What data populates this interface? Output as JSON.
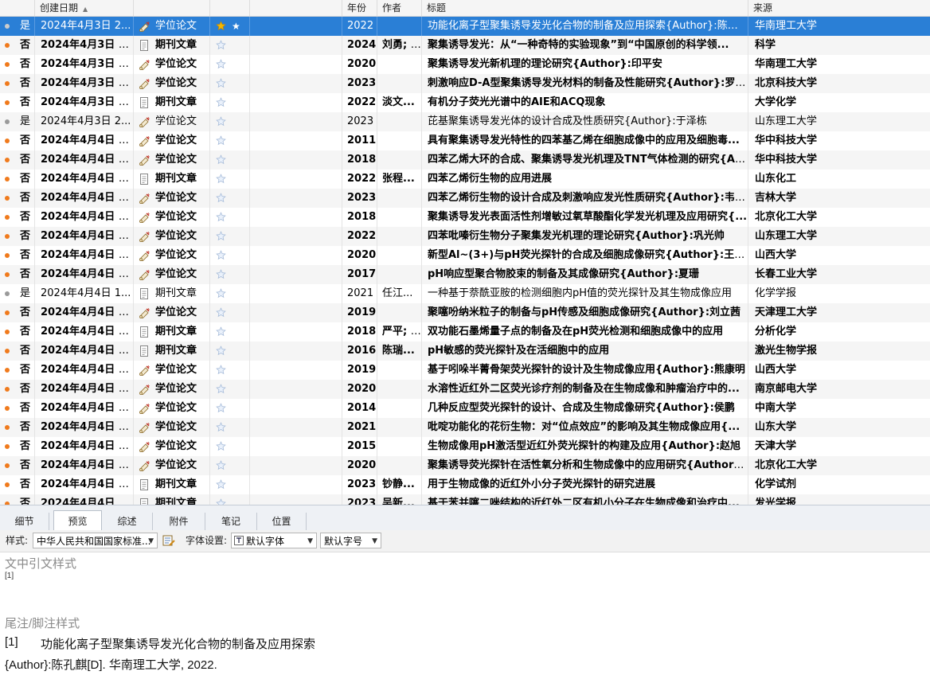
{
  "columns": {
    "created": "创建日期",
    "year": "年份",
    "author": "作者",
    "title": "标题",
    "source": "来源"
  },
  "rows": [
    {
      "read": "是",
      "date": "2024年4月3日 2...",
      "type": "学位论文",
      "rating": 1,
      "year": "2022",
      "author": "",
      "title": "功能化离子型聚集诱导发光化合物的制备及应用探索{Author}:陈孔麒",
      "source": "华南理工大学"
    },
    {
      "read": "否",
      "date": "2024年4月3日 2...",
      "type": "期刊文章",
      "rating": 0,
      "year": "2024",
      "author": "刘勇; ...",
      "title": "聚集诱导发光：从“一种奇特的实验现象”到“中国原创的科学领...",
      "source": "科学"
    },
    {
      "read": "否",
      "date": "2024年4月3日 2...",
      "type": "学位论文",
      "rating": 0,
      "year": "2020",
      "author": "",
      "title": "聚集诱导发光新机理的理论研究{Author}:印平安",
      "source": "华南理工大学"
    },
    {
      "read": "否",
      "date": "2024年4月3日 2...",
      "type": "学位论文",
      "rating": 0,
      "year": "2023",
      "author": "",
      "title": "刺激响应D-A型聚集诱导发光材料的制备及性能研究{Author}:罗玮华",
      "source": "北京科技大学"
    },
    {
      "read": "否",
      "date": "2024年4月3日 2...",
      "type": "期刊文章",
      "rating": 0,
      "year": "2022",
      "author": "淡文...",
      "title": "有机分子荧光光谱中的AIE和ACQ现象",
      "source": "大学化学"
    },
    {
      "read": "是",
      "date": "2024年4月3日 2...",
      "type": "学位论文",
      "rating": 0,
      "year": "2023",
      "author": "",
      "title": "芘基聚集诱导发光体的设计合成及性质研究{Author}:于泽栋",
      "source": "山东理工大学"
    },
    {
      "read": "否",
      "date": "2024年4月4日 1...",
      "type": "学位论文",
      "rating": 0,
      "year": "2011",
      "author": "",
      "title": "具有聚集诱导发光特性的四苯基乙烯在细胞成像中的应用及细胞毒...",
      "source": "华中科技大学"
    },
    {
      "read": "否",
      "date": "2024年4月4日 1...",
      "type": "学位论文",
      "rating": 0,
      "year": "2018",
      "author": "",
      "title": "四苯乙烯大环的合成、聚集诱导发光机理及TNT气体检测的研究{Aut.",
      "source": "华中科技大学"
    },
    {
      "read": "否",
      "date": "2024年4月4日 1...",
      "type": "期刊文章",
      "rating": 0,
      "year": "2022",
      "author": "张程...",
      "title": "四苯乙烯衍生物的应用进展",
      "source": "山东化工"
    },
    {
      "read": "否",
      "date": "2024年4月4日 1...",
      "type": "学位论文",
      "rating": 0,
      "year": "2023",
      "author": "",
      "title": "四苯乙烯衍生物的设计合成及刺激响应发光性质研究{Author}:韦宁德",
      "source": "吉林大学"
    },
    {
      "read": "否",
      "date": "2024年4月4日 1...",
      "type": "学位论文",
      "rating": 0,
      "year": "2018",
      "author": "",
      "title": "聚集诱导发光表面活性剂增敏过氧草酸酯化学发光机理及应用研究{...",
      "source": "北京化工大学"
    },
    {
      "read": "否",
      "date": "2024年4月4日 1...",
      "type": "学位论文",
      "rating": 0,
      "year": "2022",
      "author": "",
      "title": "四苯吡嗪衍生物分子聚集发光机理的理论研究{Author}:巩光帅",
      "source": "山东理工大学"
    },
    {
      "read": "否",
      "date": "2024年4月4日 1...",
      "type": "学位论文",
      "rating": 0,
      "year": "2020",
      "author": "",
      "title": "新型Al~(3+)与pH荧光探针的合成及细胞成像研究{Author}:王宇斌",
      "source": "山西大学"
    },
    {
      "read": "否",
      "date": "2024年4月4日 1...",
      "type": "学位论文",
      "rating": 0,
      "year": "2017",
      "author": "",
      "title": "pH响应型聚合物胶束的制备及其成像研究{Author}:夏珊",
      "source": "长春工业大学"
    },
    {
      "read": "是",
      "date": "2024年4月4日 1...",
      "type": "期刊文章",
      "rating": 0,
      "year": "2021",
      "author": "任江...",
      "title": "一种基于萘酰亚胺的检测细胞内pH值的荧光探针及其生物成像应用",
      "source": "化学学报"
    },
    {
      "read": "否",
      "date": "2024年4月4日 1...",
      "type": "学位论文",
      "rating": 0,
      "year": "2019",
      "author": "",
      "title": "聚噻吩纳米粒子的制备与pH传感及细胞成像研究{Author}:刘立茜",
      "source": "天津理工大学"
    },
    {
      "read": "否",
      "date": "2024年4月4日 1...",
      "type": "期刊文章",
      "rating": 0,
      "year": "2018",
      "author": "严平; ...",
      "title": "双功能石墨烯量子点的制备及在pH荧光检测和细胞成像中的应用",
      "source": "分析化学"
    },
    {
      "read": "否",
      "date": "2024年4月4日 1...",
      "type": "期刊文章",
      "rating": 0,
      "year": "2016",
      "author": "陈瑞...",
      "title": "pH敏感的荧光探针及在活细胞中的应用",
      "source": "激光生物学报"
    },
    {
      "read": "否",
      "date": "2024年4月4日 1...",
      "type": "学位论文",
      "rating": 0,
      "year": "2019",
      "author": "",
      "title": "基于吲哚半菁骨架荧光探针的设计及生物成像应用{Author}:熊康明",
      "source": "山西大学"
    },
    {
      "read": "否",
      "date": "2024年4月4日 1...",
      "type": "学位论文",
      "rating": 0,
      "year": "2020",
      "author": "",
      "title": "水溶性近红外二区荧光诊疗剂的制备及在生物成像和肿瘤治疗中的...",
      "source": "南京邮电大学"
    },
    {
      "read": "否",
      "date": "2024年4月4日 1...",
      "type": "学位论文",
      "rating": 0,
      "year": "2014",
      "author": "",
      "title": "几种反应型荧光探针的设计、合成及生物成像研究{Author}:侯鹏",
      "source": "中南大学"
    },
    {
      "read": "否",
      "date": "2024年4月4日 1...",
      "type": "学位论文",
      "rating": 0,
      "year": "2021",
      "author": "",
      "title": "吡啶功能化的花衍生物：对“位点效应”的影响及其生物成像应用{...",
      "source": "山东大学"
    },
    {
      "read": "否",
      "date": "2024年4月4日 1...",
      "type": "学位论文",
      "rating": 0,
      "year": "2015",
      "author": "",
      "title": "生物成像用pH激活型近红外荧光探针的构建及应用{Author}:赵旭",
      "source": "天津大学"
    },
    {
      "read": "否",
      "date": "2024年4月4日 1...",
      "type": "学位论文",
      "rating": 0,
      "year": "2020",
      "author": "",
      "title": "聚集诱导荧光探针在活性氧分析和生物成像中的应用研究{Author}:...",
      "source": "北京化工大学"
    },
    {
      "read": "否",
      "date": "2024年4月4日 1...",
      "type": "期刊文章",
      "rating": 0,
      "year": "2023",
      "author": "钞静...",
      "title": "用于生物成像的近红外小分子荧光探针的研究进展",
      "source": "化学试剂"
    },
    {
      "read": "否",
      "date": "2024年4月4日 1...",
      "type": "期刊文章",
      "rating": 0,
      "year": "2023",
      "author": "吴新...",
      "title": "基于苯并噻二唑结构的近红外二区有机小分子在生物成像和治疗中...",
      "source": "发光学报"
    }
  ],
  "tabs": [
    "细节",
    "预览",
    "综述",
    "附件",
    "笔记",
    "位置"
  ],
  "active_tab": 1,
  "toolbar": {
    "style_label": "样式:",
    "style_value": "中华人民共和国国家标准...",
    "font_label": "字体设置:",
    "font_value": "默认字体",
    "size_value": "默认字号"
  },
  "preview": {
    "intext_heading": "文中引文样式",
    "intext_value": "[1]",
    "note_heading": "尾注/脚注样式",
    "ref_number": "[1]",
    "ref_line1": "功能化离子型聚集诱导发光化合物的制备及应用探索",
    "ref_line2": "{Author}:陈孔麒[D]. 华南理工大学, 2022."
  },
  "colors": {
    "selected": "#2a7fd6",
    "unread_dot": "#f07a1c",
    "read_dot": "#9a9a9a",
    "star": "#f5b800"
  }
}
